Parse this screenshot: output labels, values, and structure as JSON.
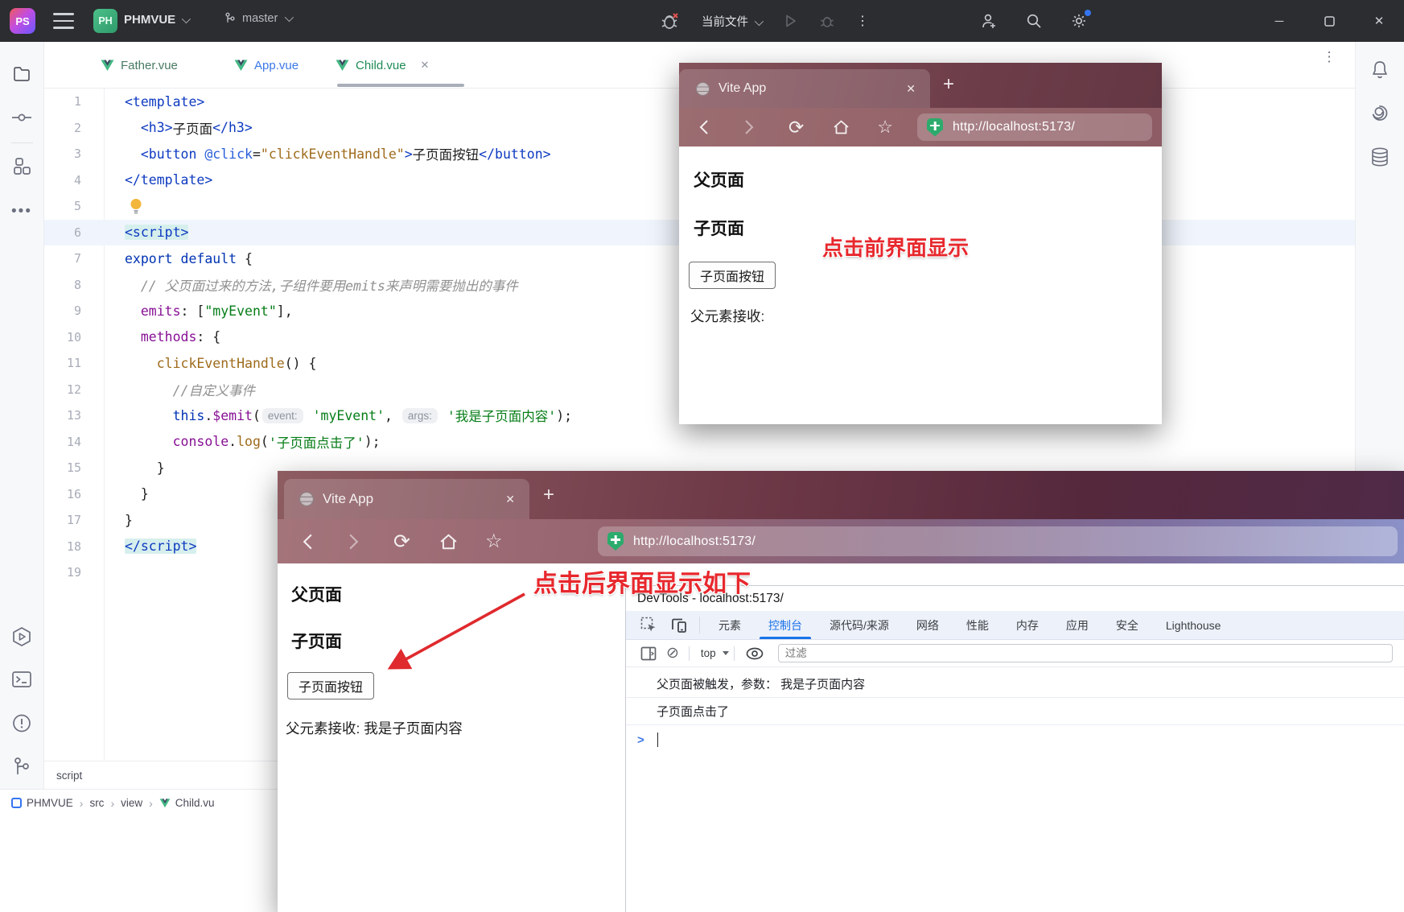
{
  "colors": {
    "ide_titlebar": "#2b2d30",
    "accent_blue": "#3574f0",
    "devtools_blue": "#1a73e8",
    "annotation_red": "#e7282d",
    "vue_green": "#41b883",
    "vue_dark": "#35495e",
    "string_green": "#067d17",
    "keyword_blue": "#0033b3"
  },
  "ide": {
    "titlebar": {
      "logo": "PS",
      "project_badge": "PH",
      "project_name": "PHMVUE",
      "branch_name": "master",
      "run_config": "当前文件",
      "minimize": "─",
      "close": "✕"
    },
    "tabs": [
      {
        "label": "Father.vue",
        "color": "#4a7a63",
        "active": false
      },
      {
        "label": "App.vue",
        "color": "#3b78e7",
        "active": false
      },
      {
        "label": "Child.vue",
        "color": "#1f8a55",
        "active": true,
        "close": "✕"
      }
    ],
    "editor": {
      "lines": [
        {
          "n": 1,
          "tokens": [
            [
              "tag",
              "<template>"
            ]
          ]
        },
        {
          "n": 2,
          "tokens": [
            [
              "plain",
              "  "
            ],
            [
              "tag",
              "<h3>"
            ],
            [
              "plain",
              "子页面"
            ],
            [
              "tag",
              "</h3>"
            ]
          ]
        },
        {
          "n": 3,
          "tokens": [
            [
              "plain",
              "  "
            ],
            [
              "tag",
              "<button "
            ],
            [
              "attr",
              "@click"
            ],
            [
              "plain",
              "="
            ],
            [
              "fn",
              "\"clickEventHandle\""
            ],
            [
              "tag",
              ">"
            ],
            [
              "plain",
              "子页面按钮"
            ],
            [
              "tag",
              "</button>"
            ]
          ]
        },
        {
          "n": 4,
          "tokens": [
            [
              "tag",
              "</template>"
            ]
          ]
        },
        {
          "n": 5,
          "tokens": [
            [
              "bulb",
              ""
            ]
          ]
        },
        {
          "n": 6,
          "hl": true,
          "tokens": [
            [
              "taghl",
              "<script>"
            ]
          ]
        },
        {
          "n": 7,
          "tokens": [
            [
              "kw",
              "export"
            ],
            [
              "plain",
              " "
            ],
            [
              "kw",
              "default"
            ],
            [
              "plain",
              " {"
            ]
          ]
        },
        {
          "n": 8,
          "tokens": [
            [
              "plain",
              "  "
            ],
            [
              "cmt",
              "// 父页面过来的方法,子组件要用emits来声明需要抛出的事件"
            ]
          ]
        },
        {
          "n": 9,
          "tokens": [
            [
              "plain",
              "  "
            ],
            [
              "prop",
              "emits"
            ],
            [
              "plain",
              ": ["
            ],
            [
              "str",
              "\"myEvent\""
            ],
            [
              "plain",
              "],"
            ]
          ]
        },
        {
          "n": 10,
          "tokens": [
            [
              "plain",
              "  "
            ],
            [
              "prop",
              "methods"
            ],
            [
              "plain",
              ": {"
            ]
          ]
        },
        {
          "n": 11,
          "tokens": [
            [
              "plain",
              "    "
            ],
            [
              "fn",
              "clickEventHandle"
            ],
            [
              "plain",
              "() {"
            ]
          ]
        },
        {
          "n": 12,
          "tokens": [
            [
              "plain",
              "      "
            ],
            [
              "cmt",
              "//自定义事件"
            ]
          ]
        },
        {
          "n": 13,
          "tokens": [
            [
              "plain",
              "      "
            ],
            [
              "kw",
              "this"
            ],
            [
              "plain",
              "."
            ],
            [
              "prop",
              "$emit"
            ],
            [
              "plain",
              "("
            ],
            [
              "hint",
              "event:"
            ],
            [
              "plain",
              " "
            ],
            [
              "str",
              "'myEvent'"
            ],
            [
              "plain",
              ", "
            ],
            [
              "hint",
              "args:"
            ],
            [
              "plain",
              " "
            ],
            [
              "str",
              "'我是子页面内容'"
            ],
            [
              "plain",
              ");"
            ]
          ]
        },
        {
          "n": 14,
          "tokens": [
            [
              "plain",
              "      "
            ],
            [
              "prop",
              "console"
            ],
            [
              "plain",
              "."
            ],
            [
              "fn",
              "log"
            ],
            [
              "plain",
              "("
            ],
            [
              "str",
              "'子页面点击了'"
            ],
            [
              "plain",
              ");"
            ]
          ]
        },
        {
          "n": 15,
          "tokens": [
            [
              "plain",
              "    }"
            ]
          ]
        },
        {
          "n": 16,
          "tokens": [
            [
              "plain",
              "  }"
            ]
          ]
        },
        {
          "n": 17,
          "tokens": [
            [
              "plain",
              "}"
            ]
          ]
        },
        {
          "n": 18,
          "tokens": [
            [
              "taghl",
              "</script>"
            ]
          ]
        },
        {
          "n": 19,
          "tokens": []
        }
      ]
    },
    "breadcrumb_tag": "script",
    "navbar": [
      {
        "label": "PHMVUE",
        "icon": "module"
      },
      {
        "label": "src"
      },
      {
        "label": "view"
      },
      {
        "label": "Child.vu",
        "icon": "vue"
      }
    ]
  },
  "win1": {
    "tab_title": "Vite App",
    "tab_close": "✕",
    "new_tab": "+",
    "reload_glyph": "⟳",
    "star_glyph": "☆",
    "url": "http://localhost:5173/",
    "page": {
      "parent_heading": "父页面",
      "child_heading": "子页面",
      "button_label": "子页面按钮",
      "receive_text": "父元素接收:"
    },
    "annotation": "点击前界面显示"
  },
  "win2": {
    "tab_title": "Vite App",
    "tab_close": "✕",
    "new_tab": "+",
    "reload_glyph": "⟳",
    "star_glyph": "☆",
    "url": "http://localhost:5173/",
    "page": {
      "parent_heading": "父页面",
      "child_heading": "子页面",
      "button_label": "子页面按钮",
      "receive_text": "父元素接收: 我是子页面内容"
    },
    "annotation": "点击后界面显示如下"
  },
  "devtools": {
    "title": "DevTools - localhost:5173/",
    "tabs": [
      "元素",
      "控制台",
      "源代码/来源",
      "网络",
      "性能",
      "内存",
      "应用",
      "安全",
      "Lighthouse"
    ],
    "active_tab_index": 1,
    "context_selector": "top",
    "filter_placeholder": "过滤",
    "clear_glyph": "⊘",
    "console_messages": [
      "父页面被触发，参数： 我是子页面内容",
      "子页面点击了"
    ],
    "prompt_symbol": ">"
  }
}
